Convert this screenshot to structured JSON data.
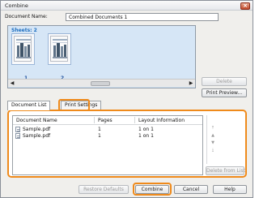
{
  "window": {
    "title": "Combine",
    "close_glyph": "×"
  },
  "document_name": {
    "label": "Document Name:",
    "value": "Combined Documents 1"
  },
  "sheets": {
    "label": "Sheets: 2",
    "items": [
      {
        "number": "1"
      },
      {
        "number": "2"
      }
    ],
    "scroll_left": "◀",
    "scroll_right": "▶"
  },
  "side_buttons": {
    "delete": "Delete",
    "print_preview": "Print Preview..."
  },
  "tabs": {
    "document_list": "Document List",
    "print_settings": "Print Settings"
  },
  "table": {
    "columns": [
      "Document Name",
      "Pages",
      "Layout Information"
    ],
    "rows": [
      {
        "name": "Sample.pdf",
        "pages": "1",
        "layout": "1 on 1"
      },
      {
        "name": "Sample.pdf",
        "pages": "1",
        "layout": "1 on 1"
      }
    ]
  },
  "list_buttons": {
    "delete_from_list": "Delete from List"
  },
  "order_icons": [
    "move-top-icon",
    "move-up-icon",
    "move-down-icon",
    "move-bottom-icon"
  ],
  "footer": {
    "restore_defaults": "Restore Defaults",
    "combine": "Combine",
    "cancel": "Cancel",
    "help": "Help"
  },
  "colors": {
    "highlight": "#ef8a1b",
    "sheet_panel": "#d6e6f6",
    "sheets_label": "#1f6fc0"
  }
}
